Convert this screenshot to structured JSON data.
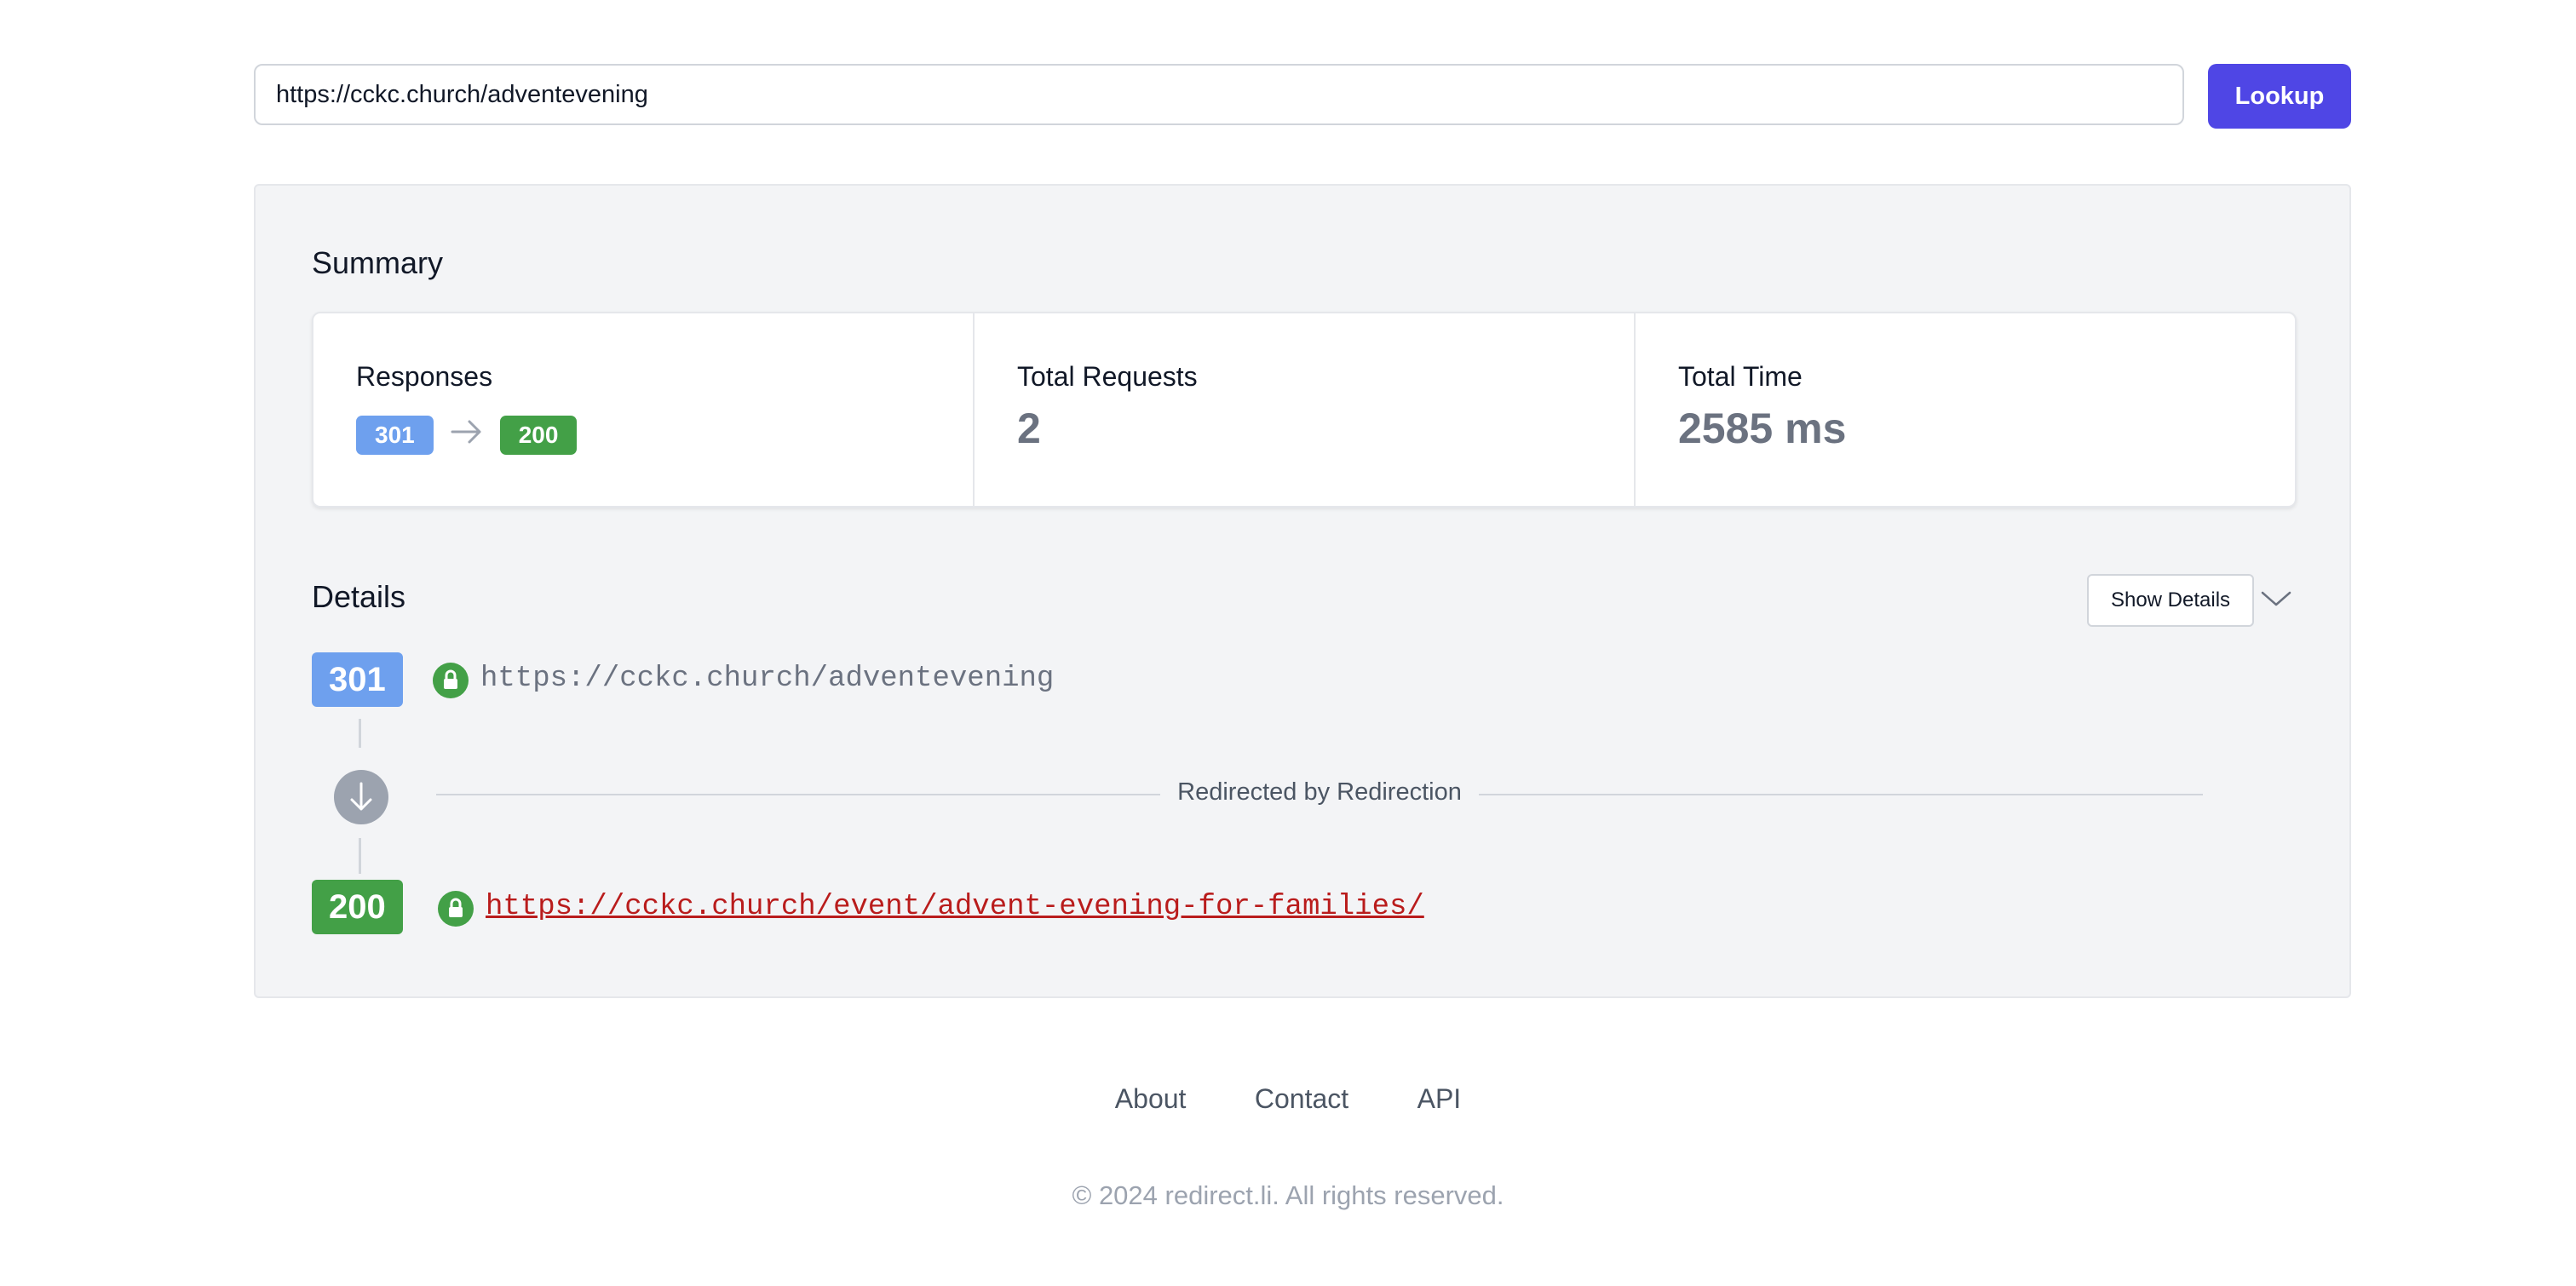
{
  "lookup": {
    "url_value": "https://cckc.church/adventevening",
    "button_label": "Lookup"
  },
  "summary": {
    "title": "Summary",
    "responses_label": "Responses",
    "response_codes": [
      "301",
      "200"
    ],
    "total_requests_label": "Total Requests",
    "total_requests_value": "2",
    "total_time_label": "Total Time",
    "total_time_value": "2585 ms"
  },
  "details": {
    "title": "Details",
    "show_details_label": "Show Details",
    "hops": [
      {
        "status": "301",
        "url": "https://cckc.church/adventevening",
        "secure": true
      },
      {
        "status": "200",
        "url": "https://cckc.church/event/advent-evening-for-families/",
        "secure": true
      }
    ],
    "redirect_label": "Redirected by Redirection"
  },
  "footer": {
    "links": [
      "About",
      "Contact",
      "API"
    ],
    "copyright": "© 2024 redirect.li. All rights reserved."
  },
  "colors": {
    "accent": "#4f46e5",
    "status_301": "#6ea0ee",
    "status_200": "#43a047",
    "lock": "#43a047",
    "final_url": "#b91c1c"
  }
}
